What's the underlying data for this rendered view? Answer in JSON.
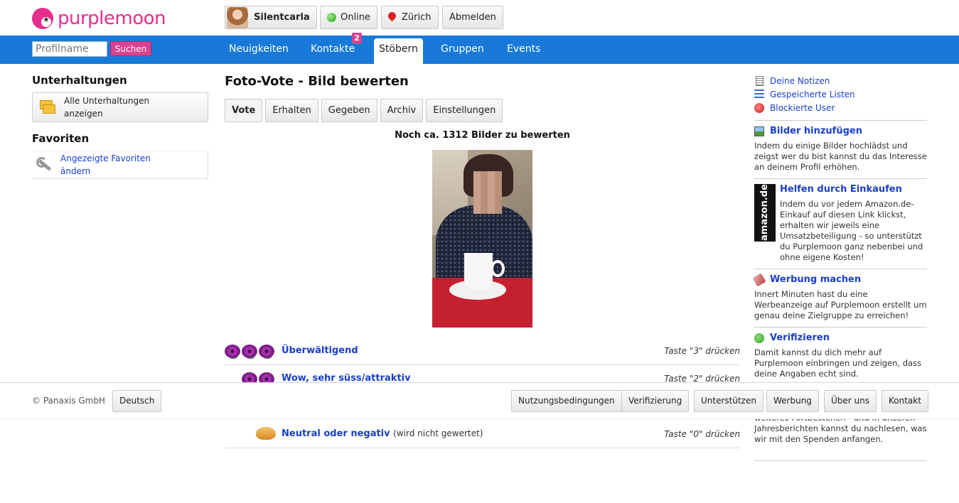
{
  "header": {
    "logo_text": "purplemoon",
    "user_name": "Silentcarla",
    "status": "Online",
    "location": "Zürich",
    "logout": "Abmelden"
  },
  "nav": {
    "search_placeholder": "Profilname",
    "search_button": "Suchen",
    "items": [
      "Neuigkeiten",
      "Kontakte",
      "Stöbern",
      "Gruppen",
      "Events"
    ],
    "contacts_badge": "2"
  },
  "left": {
    "conversations_title": "Unterhaltungen",
    "all_conversations": "Alle Unterhaltungen anzeigen",
    "favorites_title": "Favoriten",
    "favorites_link": "Angezeigte Favoriten ändern"
  },
  "main": {
    "title": "Foto-Vote - Bild bewerten",
    "tabs": [
      "Vote",
      "Erhalten",
      "Gegeben",
      "Archiv",
      "Einstellungen"
    ],
    "remaining": "Noch ca. 1312 Bilder zu bewerten",
    "votes": [
      {
        "label": "Überwältigend",
        "note": "",
        "key": "Taste \"3\" drücken"
      },
      {
        "label": "Wow, sehr süss/attraktiv",
        "note": "",
        "key": "Taste \"2\" drücken"
      },
      {
        "label": "Neutral oder negativ",
        "note": "(wird nicht gewertet)",
        "key": "Taste \"0\" drücken"
      }
    ]
  },
  "right": {
    "links": [
      "Deine Notizen",
      "Gespeicherte Listen",
      "Blockierte User"
    ],
    "add_images_title": "Bilder hinzufügen",
    "add_images_text": "Indem du einige Bilder hochlädst und zeigst wer du bist kannst du das Interesse an deinem Profil erhöhen.",
    "amazon_logo": "amazon.de",
    "shopping_title": "Helfen durch Einkaufen",
    "shopping_text": "Indem du vor jedem Amazon.de-Einkauf auf diesen Link klickst, erhalten wir jeweils eine Umsatzbeteiligung - so unterstützt du Purplemoon ganz nebenbei und ohne eigene Kosten!",
    "ads_title": "Werbung machen",
    "ads_text": "Innert Minuten hast du eine Werbeanzeige auf Purplemoon erstellt um genau deine Zielgruppe zu erreichen!",
    "verify_title": "Verifizieren",
    "verify_text": "Damit kannst du dich mehr auf Purplemoon einbringen und zeigen, dass deine Angaben echt sind.",
    "donation_text": "Mit einer Spende unterstützt du unser weiteres Fortbestehen - und in unseren Jahresberichten kannst du nachlesen, was wir mit den Spenden anfangen."
  },
  "footer": {
    "copyright": "© Panaxis GmbH",
    "language": "Deutsch",
    "links": [
      "Nutzungsbedingungen",
      "Verifizierung",
      "Unterstützen",
      "Werbung",
      "Über uns",
      "Kontakt"
    ]
  }
}
